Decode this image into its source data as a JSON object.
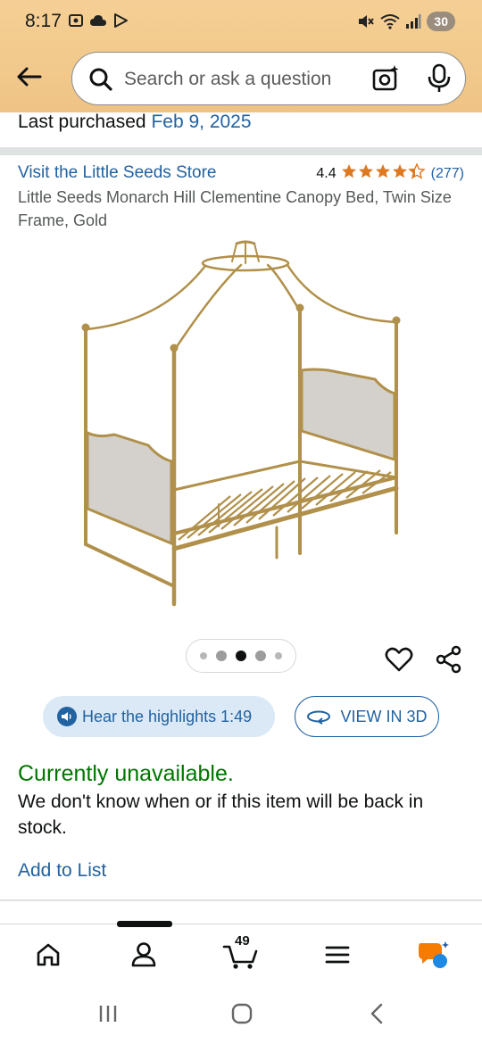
{
  "status_bar": {
    "time": "8:17",
    "battery": "30"
  },
  "search": {
    "placeholder": "Search or ask a question"
  },
  "last_purchased": {
    "label": "Last purchased",
    "date": "Feb 9, 2025"
  },
  "product": {
    "store_link": "Visit the Little Seeds Store",
    "rating_value": "4.4",
    "rating_stars": 4.4,
    "review_count": "(277)",
    "title": "Little Seeds Monarch Hill Clementine Canopy Bed, Twin Size Frame, Gold",
    "image_count": 5,
    "active_image_index": 2
  },
  "actions": {
    "hear_highlights": "Hear the highlights 1:49",
    "view_in_3d": "VIEW IN 3D"
  },
  "availability": {
    "status": "Currently unavailable.",
    "description": "We don't know when or if this item will be back in stock.",
    "add_to_list": "Add to List"
  },
  "bottom_nav": {
    "cart_count": "49",
    "items": [
      "home-icon",
      "account-icon",
      "cart-icon",
      "menu-icon",
      "rufus-icon"
    ]
  },
  "colors": {
    "header_bg": "#f2c98c",
    "link": "#2162a1",
    "star": "#de7921",
    "unavailable": "#007600"
  }
}
